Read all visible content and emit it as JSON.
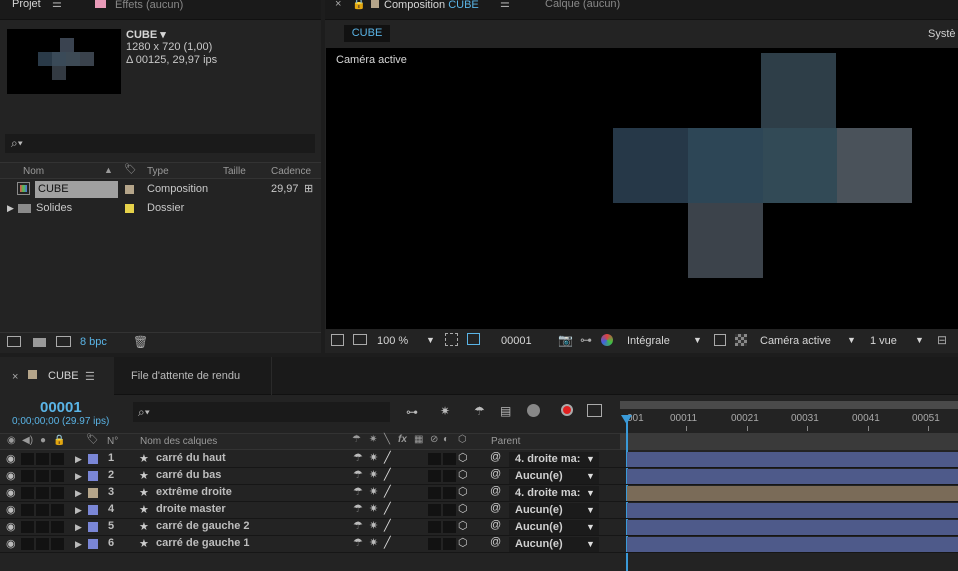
{
  "colors": {
    "accent": "#5ab4e6",
    "layer_blue": "#7a86d6",
    "layer_tan": "#b5a58a",
    "bar_blue": "#4e5a8a",
    "bar_tan": "#7a6b58",
    "cube_light": "#4d5660",
    "cube_mid": "#2e4250",
    "cube_dark": "#263848"
  },
  "project_panel": {
    "tab_project": "Projet",
    "tab_effects": "Effets  (aucun)",
    "comp_name": "CUBE",
    "comp_resolution": "1280 x 720 (1,00)",
    "comp_duration": "Δ 00125, 29,97 ips",
    "search_icon": "⌕▾",
    "columns": {
      "name": "Nom",
      "type": "Type",
      "size": "Taille",
      "fps": "Cadence"
    },
    "items": [
      {
        "name": "CUBE",
        "type": "Composition",
        "fps": "29,97",
        "color": "#b5a58a"
      },
      {
        "name": "Solides",
        "type": "Dossier",
        "fps": "",
        "color": "#e6d24a"
      }
    ],
    "bpc": "8 bpc"
  },
  "comp_panel": {
    "tab_comp_prefix": "Composition",
    "tab_comp_name": "CUBE",
    "tab_layer": "Calque  (aucun)",
    "subtab": "CUBE",
    "system_label": "Systè",
    "camera_label": "Caméra active",
    "zoom": "100 %",
    "timecode": "00001",
    "resolution": "Intégrale",
    "camera_view": "Caméra active",
    "views": "1 vue"
  },
  "timeline": {
    "tab_name": "CUBE",
    "tab_render": "File d'attente de rendu",
    "current_time": "00001",
    "current_time_sub": "0;00;00;00 (29.97 ips)",
    "header_number": "N°",
    "header_name": "Nom des calques",
    "header_parent": "Parent",
    "ruler_labels": [
      "001",
      "00011",
      "00021",
      "00031",
      "00041",
      "00051"
    ],
    "layers": [
      {
        "num": "1",
        "name": "carré du haut",
        "parent": "4. droite ma:",
        "color": "#7a86d6",
        "bar": "#4e5a8a"
      },
      {
        "num": "2",
        "name": "carré du bas",
        "parent": "Aucun(e)",
        "color": "#7a86d6",
        "bar": "#4e5a8a"
      },
      {
        "num": "3",
        "name": "extrême droite",
        "parent": "4. droite ma:",
        "color": "#b5a58a",
        "bar": "#7a6b58"
      },
      {
        "num": "4",
        "name": "droite master",
        "parent": "Aucun(e)",
        "color": "#7a86d6",
        "bar": "#4e5a8a"
      },
      {
        "num": "5",
        "name": "carré de gauche 2",
        "parent": "Aucun(e)",
        "color": "#7a86d6",
        "bar": "#4e5a8a"
      },
      {
        "num": "6",
        "name": "carré de gauche 1",
        "parent": "Aucun(e)",
        "color": "#7a86d6",
        "bar": "#4e5a8a"
      }
    ]
  }
}
